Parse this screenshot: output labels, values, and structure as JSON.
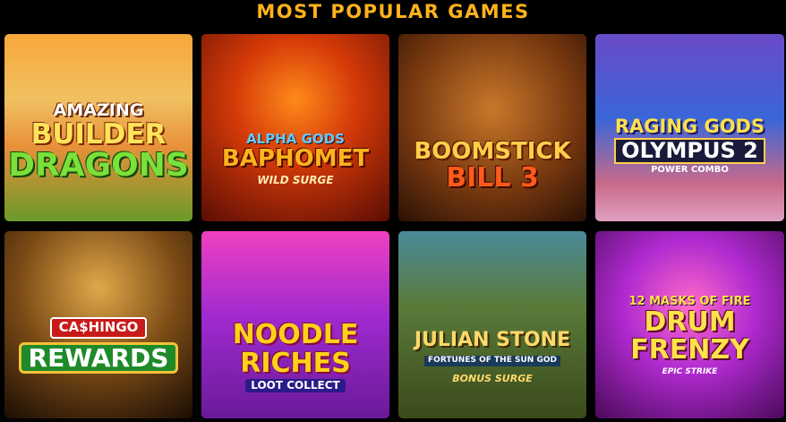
{
  "section": {
    "title": "MOST POPULAR GAMES"
  },
  "games": [
    {
      "lines": [
        "AMAZING",
        "BUILDER",
        "DRAGONS"
      ]
    },
    {
      "lines": [
        "ALPHA GODS",
        "BAPHOMET",
        "WILD SURGE"
      ]
    },
    {
      "lines": [
        "BOOMSTICK",
        "BILL 3"
      ]
    },
    {
      "lines": [
        "RAGING GODS",
        "OLYMPUS 2",
        "POWER COMBO"
      ]
    },
    {
      "lines": [
        "CA$HINGO",
        "REWARDS"
      ]
    },
    {
      "lines": [
        "NOODLE",
        "RICHES",
        "LOOT COLLECT"
      ]
    },
    {
      "lines": [
        "JULIAN STONE",
        "FORTUNES OF THE SUN GOD",
        "BONUS SURGE"
      ]
    },
    {
      "lines": [
        "12 MASKS OF FIRE",
        "DRUM",
        "FRENZY",
        "EPIC STRIKE"
      ]
    }
  ]
}
